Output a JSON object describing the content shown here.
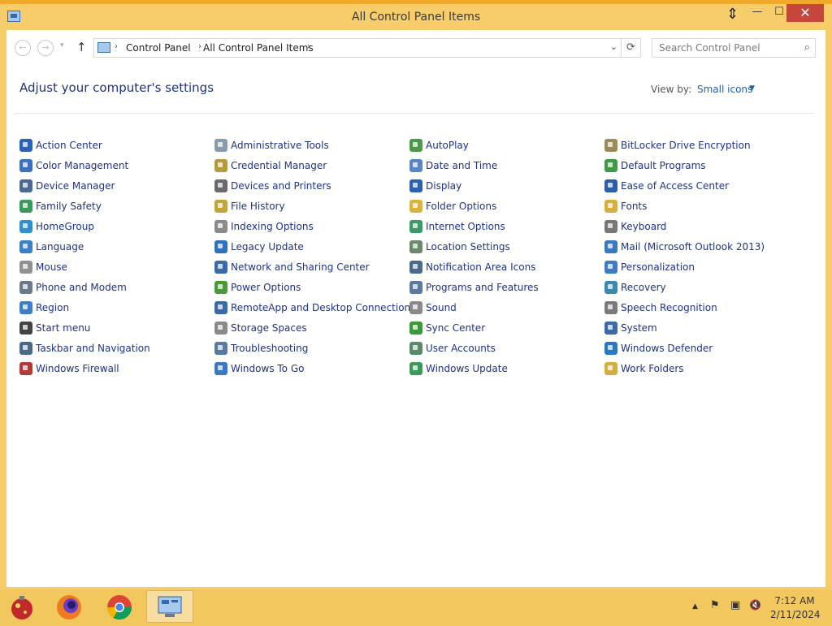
{
  "window": {
    "title": "All Control Panel Items",
    "minimize": "—",
    "maximize": "☐",
    "close": "✕"
  },
  "nav": {
    "back": "←",
    "forward": "→",
    "recent": "▾",
    "up": "↑",
    "crumb_sep": "›",
    "breadcrumbs": [
      "Control Panel",
      "All Control Panel Items"
    ],
    "dropdown": "⌄",
    "refresh": "⟳",
    "search_placeholder": "Search Control Panel",
    "search_glyph": "⌕"
  },
  "header": {
    "title": "Adjust your computer's settings",
    "view_by_label": "View by:",
    "view_by_value": "Small icons",
    "view_by_arrow": "▼"
  },
  "items": [
    {
      "label": "Action Center",
      "color": "#2b63b7"
    },
    {
      "label": "Administrative Tools",
      "color": "#8a9bab"
    },
    {
      "label": "AutoPlay",
      "color": "#4b9a4a"
    },
    {
      "label": "BitLocker Drive Encryption",
      "color": "#9b8c5a"
    },
    {
      "label": "Color Management",
      "color": "#3d6fc0"
    },
    {
      "label": "Credential Manager",
      "color": "#b59a3b"
    },
    {
      "label": "Date and Time",
      "color": "#5a86c8"
    },
    {
      "label": "Default Programs",
      "color": "#3f9b48"
    },
    {
      "label": "Device Manager",
      "color": "#4a6a92"
    },
    {
      "label": "Devices and Printers",
      "color": "#6a6a6a"
    },
    {
      "label": "Display",
      "color": "#2a62b0"
    },
    {
      "label": "Ease of Access Center",
      "color": "#2c5fa8"
    },
    {
      "label": "Family Safety",
      "color": "#3a9a5c"
    },
    {
      "label": "File History",
      "color": "#c2a53a"
    },
    {
      "label": "Folder Options",
      "color": "#d9b43c"
    },
    {
      "label": "Fonts",
      "color": "#d6b13f"
    },
    {
      "label": "HomeGroup",
      "color": "#2f8fd0"
    },
    {
      "label": "Indexing Options",
      "color": "#8a8a8a"
    },
    {
      "label": "Internet Options",
      "color": "#3b9a6a"
    },
    {
      "label": "Keyboard",
      "color": "#777777"
    },
    {
      "label": "Language",
      "color": "#3b7fc6"
    },
    {
      "label": "Legacy Update",
      "color": "#2e6fc0"
    },
    {
      "label": "Location Settings",
      "color": "#6a8a6a"
    },
    {
      "label": "Mail (Microsoft Outlook 2013)",
      "color": "#3a78c0"
    },
    {
      "label": "Mouse",
      "color": "#909090"
    },
    {
      "label": "Network and Sharing Center",
      "color": "#3a6aa8"
    },
    {
      "label": "Notification Area Icons",
      "color": "#4a6a8a"
    },
    {
      "label": "Personalization",
      "color": "#3e7cc2"
    },
    {
      "label": "Phone and Modem",
      "color": "#6a7a8a"
    },
    {
      "label": "Power Options",
      "color": "#4a9a3a"
    },
    {
      "label": "Programs and Features",
      "color": "#5a7aa0"
    },
    {
      "label": "Recovery",
      "color": "#3a8ab0"
    },
    {
      "label": "Region",
      "color": "#3b7fc6"
    },
    {
      "label": "RemoteApp and Desktop Connections",
      "color": "#3a6aa8"
    },
    {
      "label": "Sound",
      "color": "#8a8a8a"
    },
    {
      "label": "Speech Recognition",
      "color": "#7a7a7a"
    },
    {
      "label": "Start menu",
      "color": "#444444"
    },
    {
      "label": "Storage Spaces",
      "color": "#8a8a8a"
    },
    {
      "label": "Sync Center",
      "color": "#3a9a3a"
    },
    {
      "label": "System",
      "color": "#3a6aa8"
    },
    {
      "label": "Taskbar and Navigation",
      "color": "#4a6a8a"
    },
    {
      "label": "Troubleshooting",
      "color": "#5a7aa0"
    },
    {
      "label": "User Accounts",
      "color": "#5a8a6a"
    },
    {
      "label": "Windows Defender",
      "color": "#2a7ac0"
    },
    {
      "label": "Windows Firewall",
      "color": "#b03a3a"
    },
    {
      "label": "Windows To Go",
      "color": "#3a7ac0"
    },
    {
      "label": "Windows Update",
      "color": "#3a9a5a"
    },
    {
      "label": "Work Folders",
      "color": "#d0b040"
    }
  ],
  "taskbar": {
    "tray_up": "▲",
    "tray_flag": "⚑",
    "tray_network": "▣",
    "tray_volume": "🔇",
    "time": "7:12 AM",
    "date": "2/11/2024"
  }
}
